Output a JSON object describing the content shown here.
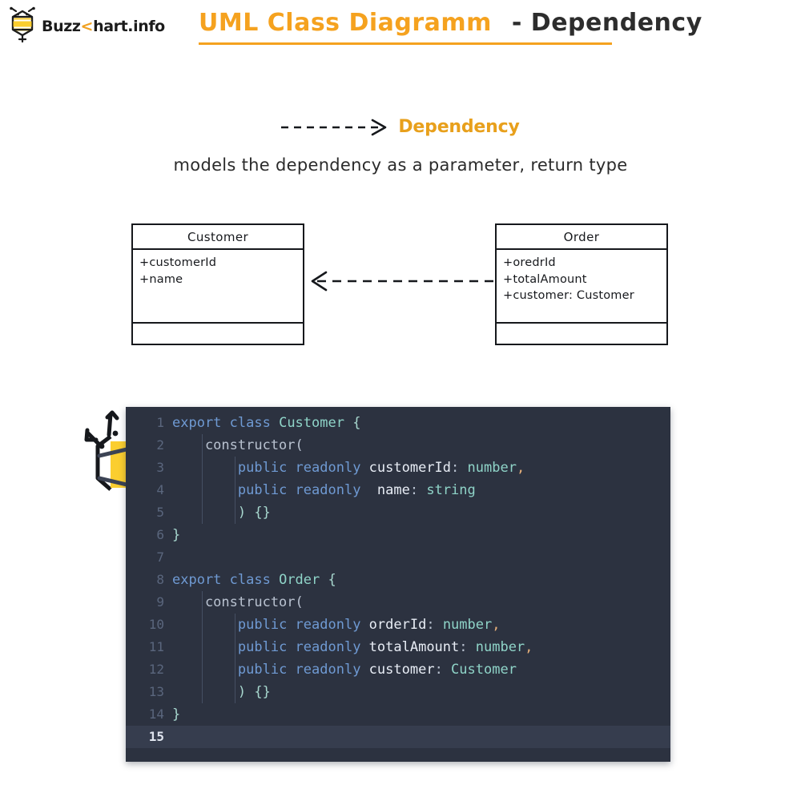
{
  "brand": {
    "name_before": "Buzz",
    "name_chevron": "<",
    "name_after": "hart.info",
    "logo_icon": "bee-logo-icon"
  },
  "header": {
    "title_main": "UML Class Diagramm",
    "title_sub": "- Dependency",
    "rule_color": "#f5a21f"
  },
  "legend": {
    "arrow_icon": "dashed-open-arrow-icon",
    "label": "Dependency",
    "label_color": "#e8a01c",
    "caption": "models the dependency as a parameter, return type"
  },
  "diagram": {
    "relationship": "dependency",
    "arrow_direction": "order-to-customer",
    "classes": [
      {
        "name": "Customer",
        "attributes": [
          "+customerId",
          "+name"
        ],
        "methods": []
      },
      {
        "name": "Order",
        "attributes": [
          "+oredrId",
          "+totalAmount",
          "+customer: Customer"
        ],
        "methods": []
      }
    ]
  },
  "code": {
    "language": "typescript",
    "background": "#2c3240",
    "active_line": 15,
    "lines": [
      {
        "n": "1",
        "indent": 0,
        "tokens": [
          {
            "t": "export ",
            "c": "kw"
          },
          {
            "t": "class ",
            "c": "kw"
          },
          {
            "t": "Customer",
            "c": "cls"
          },
          {
            "t": " {",
            "c": "brace"
          }
        ]
      },
      {
        "n": "2",
        "indent": 1,
        "tokens": [
          {
            "t": "    constructor(",
            "c": "pun"
          }
        ]
      },
      {
        "n": "3",
        "indent": 2,
        "tokens": [
          {
            "t": "        ",
            "c": "pun"
          },
          {
            "t": "public ",
            "c": "kw"
          },
          {
            "t": "readonly ",
            "c": "kw"
          },
          {
            "t": "customerId",
            "c": "id"
          },
          {
            "t": ": ",
            "c": "pun"
          },
          {
            "t": "number",
            "c": "type"
          },
          {
            "t": ",",
            "c": "comma"
          }
        ]
      },
      {
        "n": "4",
        "indent": 2,
        "tokens": [
          {
            "t": "        ",
            "c": "pun"
          },
          {
            "t": "public ",
            "c": "kw"
          },
          {
            "t": "readonly ",
            "c": "kw"
          },
          {
            "t": " name",
            "c": "id"
          },
          {
            "t": ": ",
            "c": "pun"
          },
          {
            "t": "string",
            "c": "type"
          }
        ]
      },
      {
        "n": "5",
        "indent": 2,
        "tokens": [
          {
            "t": "        ",
            "c": "pun"
          },
          {
            "t": ") {}",
            "c": "brace"
          }
        ]
      },
      {
        "n": "6",
        "indent": 0,
        "tokens": [
          {
            "t": "}",
            "c": "brace"
          }
        ]
      },
      {
        "n": "7",
        "indent": 0,
        "tokens": [
          {
            "t": "",
            "c": "pun"
          }
        ]
      },
      {
        "n": "8",
        "indent": 0,
        "tokens": [
          {
            "t": "export ",
            "c": "kw"
          },
          {
            "t": "class ",
            "c": "kw"
          },
          {
            "t": "Order",
            "c": "cls"
          },
          {
            "t": " {",
            "c": "brace"
          }
        ]
      },
      {
        "n": "9",
        "indent": 1,
        "tokens": [
          {
            "t": "    constructor(",
            "c": "pun"
          }
        ]
      },
      {
        "n": "10",
        "indent": 2,
        "tokens": [
          {
            "t": "        ",
            "c": "pun"
          },
          {
            "t": "public ",
            "c": "kw"
          },
          {
            "t": "readonly ",
            "c": "kw"
          },
          {
            "t": "orderId",
            "c": "id"
          },
          {
            "t": ": ",
            "c": "pun"
          },
          {
            "t": "number",
            "c": "type"
          },
          {
            "t": ",",
            "c": "comma"
          }
        ]
      },
      {
        "n": "11",
        "indent": 2,
        "tokens": [
          {
            "t": "        ",
            "c": "pun"
          },
          {
            "t": "public ",
            "c": "kw"
          },
          {
            "t": "readonly ",
            "c": "kw"
          },
          {
            "t": "totalAmount",
            "c": "id"
          },
          {
            "t": ": ",
            "c": "pun"
          },
          {
            "t": "number",
            "c": "type"
          },
          {
            "t": ",",
            "c": "comma"
          }
        ]
      },
      {
        "n": "12",
        "indent": 2,
        "tokens": [
          {
            "t": "        ",
            "c": "pun"
          },
          {
            "t": "public ",
            "c": "kw"
          },
          {
            "t": "readonly ",
            "c": "kw"
          },
          {
            "t": "customer",
            "c": "id"
          },
          {
            "t": ": ",
            "c": "pun"
          },
          {
            "t": "Customer",
            "c": "type"
          }
        ]
      },
      {
        "n": "13",
        "indent": 2,
        "tokens": [
          {
            "t": "        ",
            "c": "pun"
          },
          {
            "t": ") {}",
            "c": "brace"
          }
        ]
      },
      {
        "n": "14",
        "indent": 0,
        "tokens": [
          {
            "t": "}",
            "c": "brace"
          }
        ]
      },
      {
        "n": "15",
        "indent": 0,
        "tokens": [
          {
            "t": "",
            "c": "pun"
          }
        ]
      }
    ]
  }
}
